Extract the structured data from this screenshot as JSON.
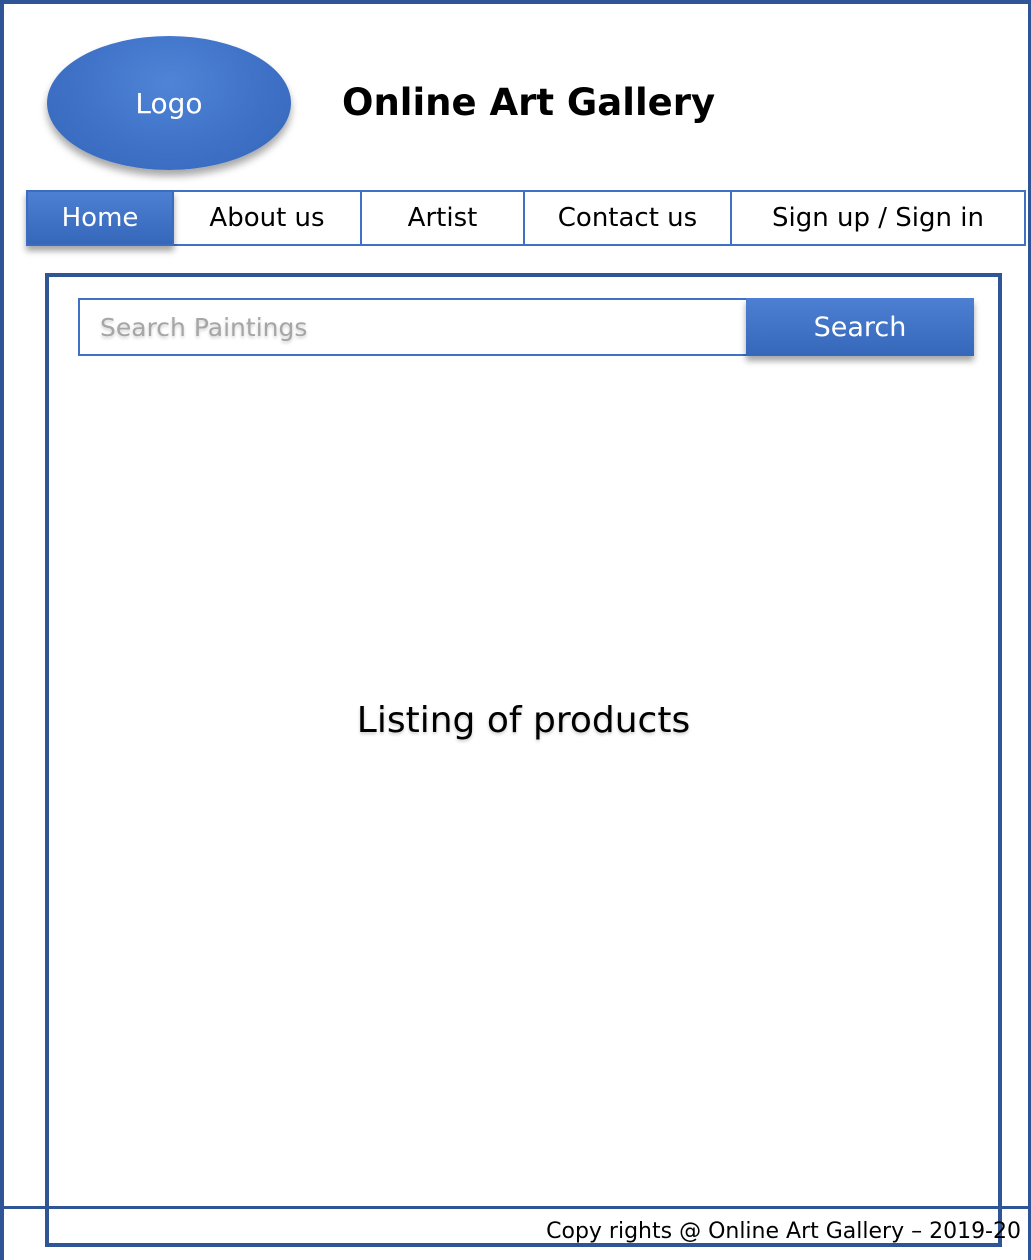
{
  "header": {
    "logo_label": "Logo",
    "title": "Online Art Gallery"
  },
  "nav": {
    "items": [
      {
        "label": "Home",
        "active": true
      },
      {
        "label": "About us",
        "active": false
      },
      {
        "label": "Artist",
        "active": false
      },
      {
        "label": "Contact us",
        "active": false
      },
      {
        "label": "Sign up / Sign in",
        "active": false
      }
    ]
  },
  "search": {
    "placeholder": "Search Paintings",
    "button_label": "Search"
  },
  "main": {
    "listing_label": "Listing of products"
  },
  "footer": {
    "copyright": "Copy rights @ Online Art Gallery – 2019-20"
  },
  "colors": {
    "accent": "#3f72c7",
    "frame": "#2f5597"
  }
}
